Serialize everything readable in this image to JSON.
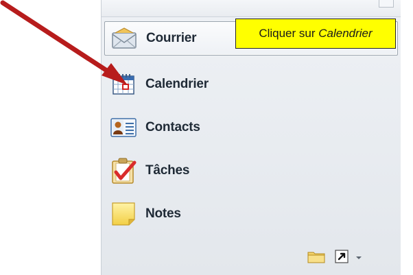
{
  "nav": {
    "items": [
      {
        "key": "mail",
        "label": "Courrier",
        "icon": "mail-icon"
      },
      {
        "key": "calendar",
        "label": "Calendrier",
        "icon": "calendar-icon"
      },
      {
        "key": "contacts",
        "label": "Contacts",
        "icon": "contacts-icon"
      },
      {
        "key": "tasks",
        "label": "Tâches",
        "icon": "tasks-icon"
      },
      {
        "key": "notes",
        "label": "Notes",
        "icon": "notes-icon"
      }
    ],
    "selected": "mail"
  },
  "callout": {
    "prefix": "Cliquer sur ",
    "emphasis": "Calendrier",
    "background": "#ffff00"
  },
  "annotation": {
    "arrow_color": "#b71c1c",
    "points_to": "calendar"
  },
  "footer": {
    "icons": [
      "folder-icon",
      "shortcut-icon",
      "chevron-down-icon"
    ]
  }
}
